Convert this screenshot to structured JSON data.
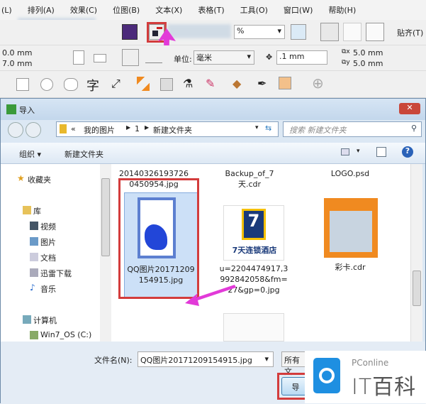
{
  "menu": [
    "(L)",
    "排列(A)",
    "效果(C)",
    "位图(B)",
    "文本(X)",
    "表格(T)",
    "工具(O)",
    "窗口(W)",
    "帮助(H)"
  ],
  "toolbar1": {
    "zoom_value": "%",
    "snap_label": "贴齐(T)"
  },
  "toolbar2": {
    "width_value": "0.0 mm",
    "height_value": "7.0 mm",
    "unit_label": "单位:",
    "unit_value": "毫米",
    "nudge_value": ".1 mm",
    "dup_x": "5.0 mm",
    "dup_y": "5.0 mm"
  },
  "toolbar3": {
    "text_tool": "字"
  },
  "dialog": {
    "title": "导入",
    "breadcrumb": [
      "«",
      "我的图片",
      "1",
      "新建文件夹"
    ],
    "search_placeholder": "搜索 新建文件夹",
    "organize_label": "组织 ▾",
    "new_folder_label": "新建文件夹",
    "nav": [
      {
        "label": "收藏夹",
        "icon": "star-icon"
      },
      {
        "label": "库",
        "icon": "library-icon"
      },
      {
        "label": "视频",
        "icon": "video-icon"
      },
      {
        "label": "图片",
        "icon": "pictures-icon"
      },
      {
        "label": "文档",
        "icon": "documents-icon"
      },
      {
        "label": "迅雷下载",
        "icon": "download-icon"
      },
      {
        "label": "音乐",
        "icon": "music-icon"
      },
      {
        "label": "计算机",
        "icon": "computer-icon"
      },
      {
        "label": "Win7_OS (C:)",
        "icon": "drive-icon"
      }
    ],
    "files": [
      {
        "name": "20140326193726 0450954.jpg"
      },
      {
        "name": "Backup_of_7天.cdr"
      },
      {
        "name": "LOGO.psd"
      },
      {
        "name": "QQ图片20171209154915.jpg",
        "selected": true
      },
      {
        "name": "u=2204474917,3992842058&fm=27&gp=0.jpg",
        "thumb_text": "7天连锁酒店"
      },
      {
        "name": "彩卡.cdr"
      }
    ],
    "filename_label": "文件名(N):",
    "filename_value": "QQ图片20171209154915.jpg",
    "filetype_value": "所有文",
    "import_button": "导"
  },
  "watermark": {
    "brand": "PConline",
    "name": "IT百科"
  },
  "colors": {
    "highlight": "#d33c3c",
    "arrow": "#e23ad8",
    "selection": "#cce0f7",
    "logo": "#1e8fe1"
  }
}
